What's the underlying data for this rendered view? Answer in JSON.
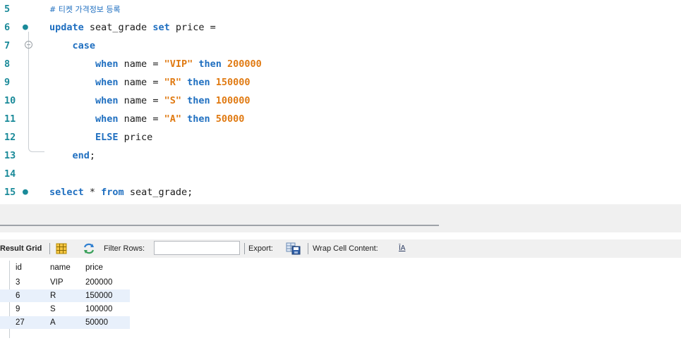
{
  "editor": {
    "lines": [
      {
        "num": "5",
        "marker": "",
        "tokens": [
          {
            "t": "cm",
            "v": "# 티켓 가격정보 등록"
          }
        ]
      },
      {
        "num": "6",
        "marker": "●",
        "tokens": [
          {
            "t": "kw",
            "v": "update"
          },
          {
            "t": "id",
            "v": " seat_grade "
          },
          {
            "t": "kw",
            "v": "set"
          },
          {
            "t": "id",
            "v": " price ="
          }
        ]
      },
      {
        "num": "7",
        "marker": "fold",
        "tokens": [
          {
            "t": "id",
            "v": "    "
          },
          {
            "t": "kw",
            "v": "case"
          }
        ]
      },
      {
        "num": "8",
        "marker": "",
        "tokens": [
          {
            "t": "id",
            "v": "        "
          },
          {
            "t": "kw",
            "v": "when"
          },
          {
            "t": "id",
            "v": " name = "
          },
          {
            "t": "str",
            "v": "\"VIP\""
          },
          {
            "t": "id",
            "v": " "
          },
          {
            "t": "kw",
            "v": "then"
          },
          {
            "t": "id",
            "v": " "
          },
          {
            "t": "num",
            "v": "200000"
          }
        ]
      },
      {
        "num": "9",
        "marker": "",
        "tokens": [
          {
            "t": "id",
            "v": "        "
          },
          {
            "t": "kw",
            "v": "when"
          },
          {
            "t": "id",
            "v": " name = "
          },
          {
            "t": "str",
            "v": "\"R\""
          },
          {
            "t": "id",
            "v": " "
          },
          {
            "t": "kw",
            "v": "then"
          },
          {
            "t": "id",
            "v": " "
          },
          {
            "t": "num",
            "v": "150000"
          }
        ]
      },
      {
        "num": "10",
        "marker": "",
        "tokens": [
          {
            "t": "id",
            "v": "        "
          },
          {
            "t": "kw",
            "v": "when"
          },
          {
            "t": "id",
            "v": " name = "
          },
          {
            "t": "str",
            "v": "\"S\""
          },
          {
            "t": "id",
            "v": " "
          },
          {
            "t": "kw",
            "v": "then"
          },
          {
            "t": "id",
            "v": " "
          },
          {
            "t": "num",
            "v": "100000"
          }
        ]
      },
      {
        "num": "11",
        "marker": "",
        "tokens": [
          {
            "t": "id",
            "v": "        "
          },
          {
            "t": "kw",
            "v": "when"
          },
          {
            "t": "id",
            "v": " name = "
          },
          {
            "t": "str",
            "v": "\"A\""
          },
          {
            "t": "id",
            "v": " "
          },
          {
            "t": "kw",
            "v": "then"
          },
          {
            "t": "id",
            "v": " "
          },
          {
            "t": "num",
            "v": "50000"
          }
        ]
      },
      {
        "num": "12",
        "marker": "",
        "tokens": [
          {
            "t": "id",
            "v": "        "
          },
          {
            "t": "kw",
            "v": "ELSE"
          },
          {
            "t": "id",
            "v": " price"
          }
        ]
      },
      {
        "num": "13",
        "marker": "",
        "tokens": [
          {
            "t": "id",
            "v": "    "
          },
          {
            "t": "kw",
            "v": "end"
          },
          {
            "t": "id",
            "v": ";"
          }
        ]
      },
      {
        "num": "14",
        "marker": "",
        "tokens": []
      },
      {
        "num": "15",
        "marker": "●",
        "tokens": [
          {
            "t": "kw",
            "v": "select"
          },
          {
            "t": "id",
            "v": " * "
          },
          {
            "t": "kw",
            "v": "from"
          },
          {
            "t": "id",
            "v": " seat_grade;"
          }
        ]
      }
    ]
  },
  "toolbar": {
    "result_grid_label": "Result Grid",
    "filter_rows_label": "Filter Rows:",
    "filter_value": "",
    "export_label": "Export:",
    "wrap_label": "Wrap Cell Content:",
    "wrap_icon_glyph": "ĪA"
  },
  "grid": {
    "columns": [
      "id",
      "name",
      "price"
    ],
    "rows": [
      [
        "3",
        "VIP",
        "200000"
      ],
      [
        "6",
        "R",
        "150000"
      ],
      [
        "9",
        "S",
        "100000"
      ],
      [
        "27",
        "A",
        "50000"
      ]
    ]
  },
  "colors": {
    "keyword": "#1f6fc0",
    "string": "#e07a12",
    "line_number": "#1a8a99",
    "row_alt": "#e8f0fb"
  }
}
